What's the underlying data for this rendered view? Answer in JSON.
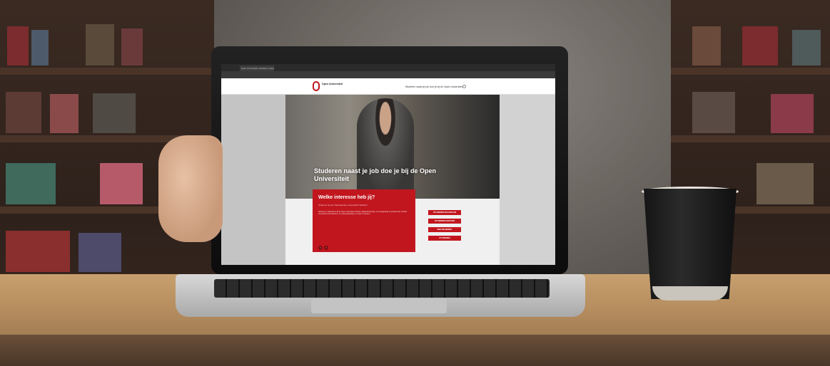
{
  "browser": {
    "tab_title": "Open Universiteit | Studeren naast je job",
    "url": "ou.nl"
  },
  "site": {
    "logo_name": "Open Universiteit",
    "tagline": "Studeren naast je job doe je bij de Open Universiteit"
  },
  "hero": {
    "title": "Studeren naast je job doe je bij de Open Universiteit"
  },
  "interest": {
    "heading": "Welke interesse heb jij?",
    "subheading": "Studeren bij een Nederlandse universiteit? Welkom!",
    "body": "Studeren in Vlaanderen bij de Open Universiteit: flexibel, afstandsonderwijs, met begeleiding op studiecentra. Ontdek ons aanbod van bachelor- en masteropleidingen en losse cursussen.",
    "pager": [
      "‹",
      "›"
    ]
  },
  "buttons": [
    {
      "label": "STUDEREN BACHELOR"
    },
    {
      "label": "STUDEREN MASTER"
    },
    {
      "label": "EEN INLEIDING"
    },
    {
      "label": "STUDEREN"
    }
  ],
  "colors": {
    "brand_red": "#c1161e"
  }
}
